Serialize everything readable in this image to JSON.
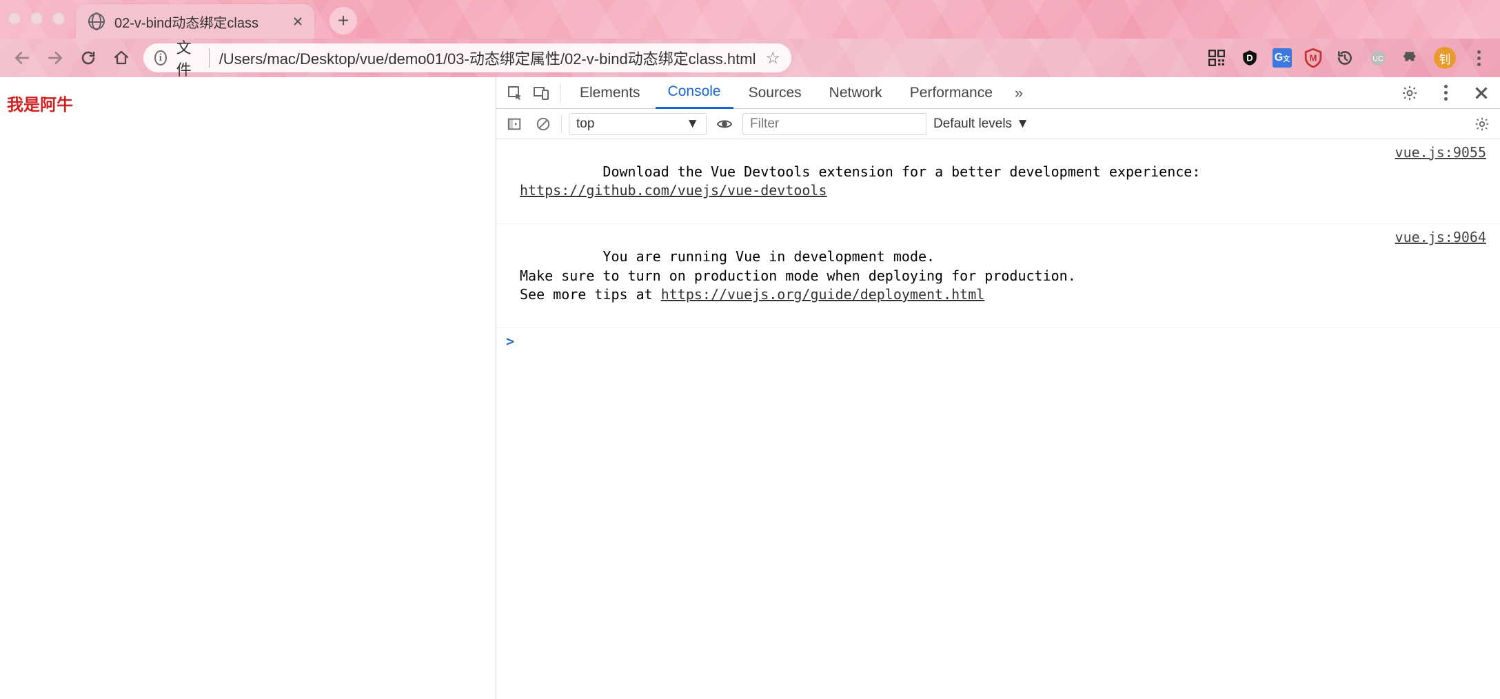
{
  "tab": {
    "title": "02-v-bind动态绑定class"
  },
  "toolbar": {
    "scheme_label": "文件",
    "url_path": "/Users/mac/Desktop/vue/demo01/03-动态绑定属性/02-v-bind动态绑定class.html",
    "profile_initial": "钊"
  },
  "page": {
    "body_text": "我是阿牛"
  },
  "devtools": {
    "tabs": [
      "Elements",
      "Console",
      "Sources",
      "Network",
      "Performance"
    ],
    "active_tab": "Console",
    "toolbar2": {
      "context": "top",
      "filter_placeholder": "Filter",
      "levels_label": "Default levels"
    },
    "logs": [
      {
        "text": "Download the Vue Devtools extension for a better development experience:\n",
        "link_text": "https://github.com/vuejs/vue-devtools",
        "source": "vue.js:9055"
      },
      {
        "text": "You are running Vue in development mode.\nMake sure to turn on production mode when deploying for production.\nSee more tips at ",
        "link_text": "https://vuejs.org/guide/deployment.html",
        "source": "vue.js:9064"
      }
    ],
    "prompt": ">"
  }
}
